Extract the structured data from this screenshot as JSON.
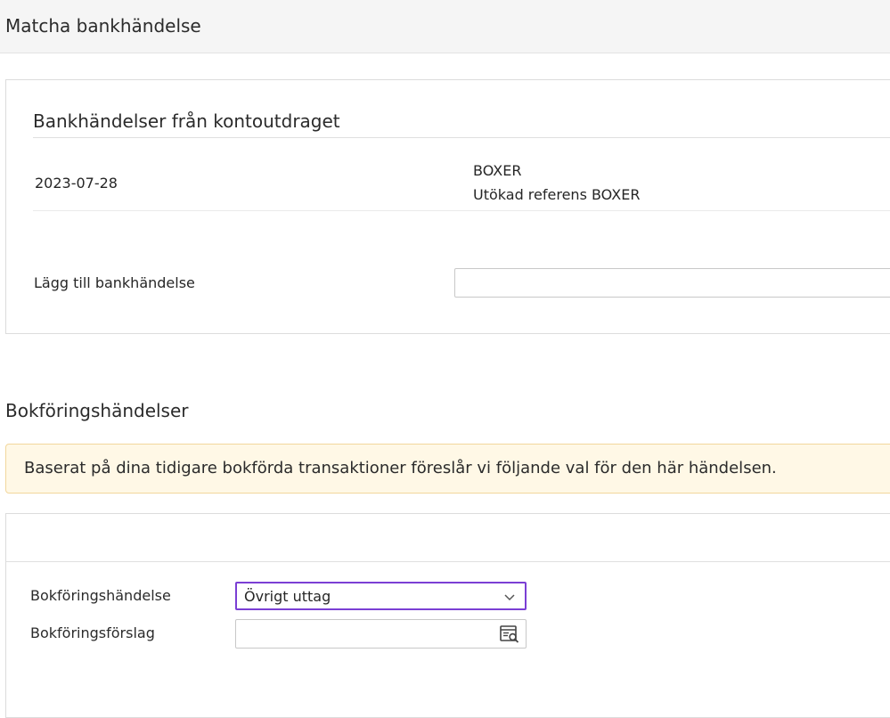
{
  "header": {
    "title": "Matcha bankhändelse"
  },
  "bank_events": {
    "heading": "Bankhändelser från kontoutdraget",
    "rows": [
      {
        "date": "2023-07-28",
        "name": "BOXER",
        "reference": "Utökad referens BOXER"
      }
    ],
    "add_label": "Lägg till bankhändelse",
    "add_value": ""
  },
  "bookkeeping": {
    "section_title": "Bokföringshändelser",
    "notice": "Baserat på dina tidigare bokförda transaktioner föreslår vi följande val för den här händelsen.",
    "event_label": "Bokföringshändelse",
    "event_selected": "Övrigt uttag",
    "proposal_label": "Bokföringsförslag",
    "proposal_value": ""
  },
  "colors": {
    "select_focus": "#7b3fd4",
    "notice_bg": "#fff8e6",
    "notice_border": "#f2d79c"
  },
  "icons": {
    "dropdown": "chevron-down-icon",
    "lookup": "document-search-icon"
  }
}
